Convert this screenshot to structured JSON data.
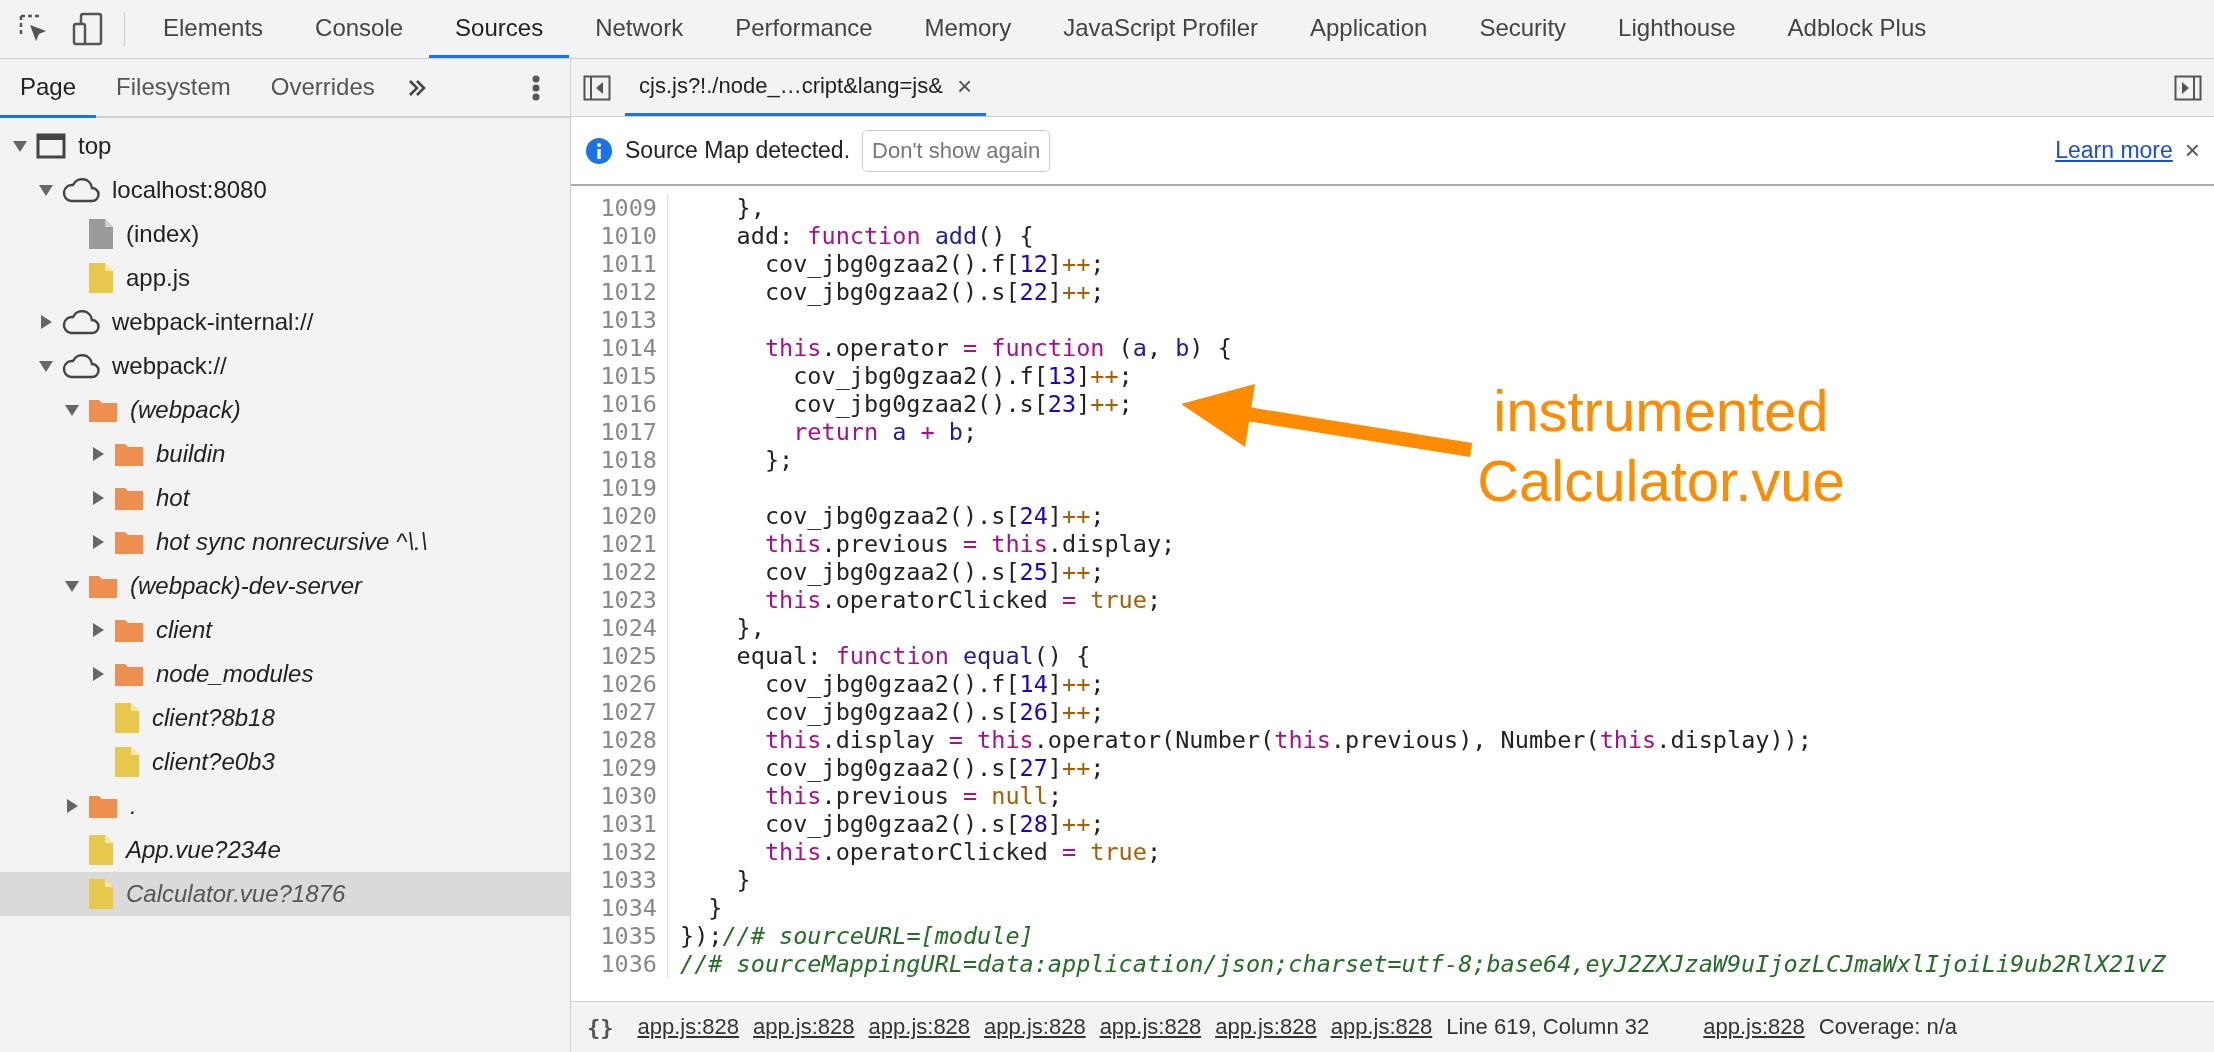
{
  "toolbar": {
    "tabs": [
      {
        "label": "Elements",
        "selected": false
      },
      {
        "label": "Console",
        "selected": false
      },
      {
        "label": "Sources",
        "selected": true
      },
      {
        "label": "Network",
        "selected": false
      },
      {
        "label": "Performance",
        "selected": false
      },
      {
        "label": "Memory",
        "selected": false
      },
      {
        "label": "JavaScript Profiler",
        "selected": false
      },
      {
        "label": "Application",
        "selected": false
      },
      {
        "label": "Security",
        "selected": false
      },
      {
        "label": "Lighthouse",
        "selected": false
      },
      {
        "label": "Adblock Plus",
        "selected": false
      }
    ]
  },
  "navigator": {
    "tabs": [
      {
        "label": "Page",
        "selected": true
      },
      {
        "label": "Filesystem",
        "selected": false
      },
      {
        "label": "Overrides",
        "selected": false
      }
    ],
    "tree": [
      {
        "label": "top",
        "kind": "frame",
        "expanded": true,
        "selected": false,
        "italic": false,
        "children": [
          {
            "label": "localhost:8080",
            "kind": "domain",
            "expanded": true,
            "selected": false,
            "italic": false,
            "children": [
              {
                "label": "(index)",
                "kind": "document",
                "selected": false,
                "italic": false
              },
              {
                "label": "app.js",
                "kind": "script",
                "selected": false,
                "italic": false
              }
            ]
          },
          {
            "label": "webpack-internal://",
            "kind": "domain",
            "expanded": false,
            "selected": false,
            "italic": false
          },
          {
            "label": "webpack://",
            "kind": "domain",
            "expanded": true,
            "selected": false,
            "italic": false,
            "children": [
              {
                "label": "(webpack)",
                "kind": "folder",
                "expanded": true,
                "selected": false,
                "italic": true,
                "children": [
                  {
                    "label": "buildin",
                    "kind": "folder",
                    "expanded": false,
                    "selected": false,
                    "italic": true
                  },
                  {
                    "label": "hot",
                    "kind": "folder",
                    "expanded": false,
                    "selected": false,
                    "italic": true
                  },
                  {
                    "label": "hot sync nonrecursive ^\\.\\",
                    "kind": "folder",
                    "expanded": false,
                    "selected": false,
                    "italic": true
                  }
                ]
              },
              {
                "label": "(webpack)-dev-server",
                "kind": "folder",
                "expanded": true,
                "selected": false,
                "italic": true,
                "children": [
                  {
                    "label": "client",
                    "kind": "folder",
                    "expanded": false,
                    "selected": false,
                    "italic": true
                  },
                  {
                    "label": "node_modules",
                    "kind": "folder",
                    "expanded": false,
                    "selected": false,
                    "italic": true
                  },
                  {
                    "label": "client?8b18",
                    "kind": "script",
                    "selected": false,
                    "italic": true
                  },
                  {
                    "label": "client?e0b3",
                    "kind": "script",
                    "selected": false,
                    "italic": true
                  }
                ]
              },
              {
                "label": ".",
                "kind": "folder",
                "expanded": false,
                "selected": false,
                "italic": true
              },
              {
                "label": "App.vue?234e",
                "kind": "script",
                "selected": false,
                "italic": true
              },
              {
                "label": "Calculator.vue?1876",
                "kind": "script",
                "selected": true,
                "italic": true
              }
            ]
          }
        ]
      }
    ]
  },
  "editor": {
    "file_tab": {
      "label": "cjs.js?!./node_…cript&lang=js&",
      "close": "×",
      "selected": true
    },
    "infobar": {
      "message": "Source Map detected.",
      "button": "Don't show again",
      "link": "Learn more",
      "close": "×"
    },
    "lines": [
      {
        "number": "1009",
        "tokens": [
          {
            "kind": "p",
            "text": "    },"
          }
        ]
      },
      {
        "number": "1010",
        "tokens": [
          {
            "kind": "p",
            "text": "    add: "
          },
          {
            "kind": "k",
            "text": "function"
          },
          {
            "kind": "d",
            "text": " add"
          },
          {
            "kind": "p",
            "text": "() {"
          }
        ]
      },
      {
        "number": "1011",
        "tokens": [
          {
            "kind": "p",
            "text": "      cov_jbg0gzaa2().f["
          },
          {
            "kind": "n",
            "text": "12"
          },
          {
            "kind": "p",
            "text": "]"
          },
          {
            "kind": "o",
            "text": "++"
          },
          {
            "kind": "p",
            "text": ";"
          }
        ]
      },
      {
        "number": "1012",
        "tokens": [
          {
            "kind": "p",
            "text": "      cov_jbg0gzaa2().s["
          },
          {
            "kind": "n",
            "text": "22"
          },
          {
            "kind": "p",
            "text": "]"
          },
          {
            "kind": "o",
            "text": "++"
          },
          {
            "kind": "p",
            "text": ";"
          }
        ]
      },
      {
        "number": "1013"
      },
      {
        "number": "1014",
        "tokens": [
          {
            "kind": "k",
            "text": "      this"
          },
          {
            "kind": "p",
            "text": ".operator "
          },
          {
            "kind": "k",
            "text": "= function"
          },
          {
            "kind": "p",
            "text": " ("
          },
          {
            "kind": "d",
            "text": "a"
          },
          {
            "kind": "p",
            "text": ", "
          },
          {
            "kind": "d",
            "text": "b"
          },
          {
            "kind": "p",
            "text": ") {"
          }
        ]
      },
      {
        "number": "1015",
        "tokens": [
          {
            "kind": "p",
            "text": "        cov_jbg0gzaa2().f["
          },
          {
            "kind": "n",
            "text": "13"
          },
          {
            "kind": "p",
            "text": "]"
          },
          {
            "kind": "o",
            "text": "++"
          },
          {
            "kind": "p",
            "text": ";"
          }
        ]
      },
      {
        "number": "1016",
        "tokens": [
          {
            "kind": "p",
            "text": "        cov_jbg0gzaa2().s["
          },
          {
            "kind": "n",
            "text": "23"
          },
          {
            "kind": "p",
            "text": "]"
          },
          {
            "kind": "o",
            "text": "++"
          },
          {
            "kind": "p",
            "text": ";"
          }
        ]
      },
      {
        "number": "1017",
        "tokens": [
          {
            "kind": "k",
            "text": "        return"
          },
          {
            "kind": "d",
            "text": " a"
          },
          {
            "kind": "k",
            "text": " +"
          },
          {
            "kind": "d",
            "text": " b"
          },
          {
            "kind": "p",
            "text": ";"
          }
        ]
      },
      {
        "number": "1018",
        "tokens": [
          {
            "kind": "p",
            "text": "      };"
          }
        ]
      },
      {
        "number": "1019"
      },
      {
        "number": "1020",
        "tokens": [
          {
            "kind": "p",
            "text": "      cov_jbg0gzaa2().s["
          },
          {
            "kind": "n",
            "text": "24"
          },
          {
            "kind": "p",
            "text": "]"
          },
          {
            "kind": "o",
            "text": "++"
          },
          {
            "kind": "p",
            "text": ";"
          }
        ]
      },
      {
        "number": "1021",
        "tokens": [
          {
            "kind": "k",
            "text": "      this"
          },
          {
            "kind": "p",
            "text": ".previous "
          },
          {
            "kind": "k",
            "text": "= this"
          },
          {
            "kind": "p",
            "text": ".display;"
          }
        ]
      },
      {
        "number": "1022",
        "tokens": [
          {
            "kind": "p",
            "text": "      cov_jbg0gzaa2().s["
          },
          {
            "kind": "n",
            "text": "25"
          },
          {
            "kind": "p",
            "text": "]"
          },
          {
            "kind": "o",
            "text": "++"
          },
          {
            "kind": "p",
            "text": ";"
          }
        ]
      },
      {
        "number": "1023",
        "tokens": [
          {
            "kind": "k",
            "text": "      this"
          },
          {
            "kind": "p",
            "text": ".operatorClicked "
          },
          {
            "kind": "k",
            "text": "="
          },
          {
            "kind": "v",
            "text": " true"
          },
          {
            "kind": "p",
            "text": ";"
          }
        ]
      },
      {
        "number": "1024",
        "tokens": [
          {
            "kind": "p",
            "text": "    },"
          }
        ]
      },
      {
        "number": "1025",
        "tokens": [
          {
            "kind": "p",
            "text": "    equal: "
          },
          {
            "kind": "k",
            "text": "function"
          },
          {
            "kind": "d",
            "text": " equal"
          },
          {
            "kind": "p",
            "text": "() {"
          }
        ]
      },
      {
        "number": "1026",
        "tokens": [
          {
            "kind": "p",
            "text": "      cov_jbg0gzaa2().f["
          },
          {
            "kind": "n",
            "text": "14"
          },
          {
            "kind": "p",
            "text": "]"
          },
          {
            "kind": "o",
            "text": "++"
          },
          {
            "kind": "p",
            "text": ";"
          }
        ]
      },
      {
        "number": "1027",
        "tokens": [
          {
            "kind": "p",
            "text": "      cov_jbg0gzaa2().s["
          },
          {
            "kind": "n",
            "text": "26"
          },
          {
            "kind": "p",
            "text": "]"
          },
          {
            "kind": "o",
            "text": "++"
          },
          {
            "kind": "p",
            "text": ";"
          }
        ]
      },
      {
        "number": "1028",
        "tokens": [
          {
            "kind": "k",
            "text": "      this"
          },
          {
            "kind": "p",
            "text": ".display "
          },
          {
            "kind": "k",
            "text": "= this"
          },
          {
            "kind": "p",
            "text": ".operator(Number("
          },
          {
            "kind": "k",
            "text": "this"
          },
          {
            "kind": "p",
            "text": ".previous), Number("
          },
          {
            "kind": "k",
            "text": "this"
          },
          {
            "kind": "p",
            "text": ".display));"
          }
        ]
      },
      {
        "number": "1029",
        "tokens": [
          {
            "kind": "p",
            "text": "      cov_jbg0gzaa2().s["
          },
          {
            "kind": "n",
            "text": "27"
          },
          {
            "kind": "p",
            "text": "]"
          },
          {
            "kind": "o",
            "text": "++"
          },
          {
            "kind": "p",
            "text": ";"
          }
        ]
      },
      {
        "number": "1030",
        "tokens": [
          {
            "kind": "k",
            "text": "      this"
          },
          {
            "kind": "p",
            "text": ".previous "
          },
          {
            "kind": "k",
            "text": "="
          },
          {
            "kind": "v",
            "text": " null"
          },
          {
            "kind": "p",
            "text": ";"
          }
        ]
      },
      {
        "number": "1031",
        "tokens": [
          {
            "kind": "p",
            "text": "      cov_jbg0gzaa2().s["
          },
          {
            "kind": "n",
            "text": "28"
          },
          {
            "kind": "p",
            "text": "]"
          },
          {
            "kind": "o",
            "text": "++"
          },
          {
            "kind": "p",
            "text": ";"
          }
        ]
      },
      {
        "number": "1032",
        "tokens": [
          {
            "kind": "k",
            "text": "      this"
          },
          {
            "kind": "p",
            "text": ".operatorClicked "
          },
          {
            "kind": "k",
            "text": "="
          },
          {
            "kind": "v",
            "text": " true"
          },
          {
            "kind": "p",
            "text": ";"
          }
        ]
      },
      {
        "number": "1033",
        "tokens": [
          {
            "kind": "p",
            "text": "    }"
          }
        ]
      },
      {
        "number": "1034",
        "tokens": [
          {
            "kind": "p",
            "text": "  }"
          }
        ]
      },
      {
        "number": "1035",
        "tokens": [
          {
            "kind": "p",
            "text": "});"
          },
          {
            "kind": "c",
            "text": "//# sourceURL=[module]"
          }
        ]
      },
      {
        "number": "1036",
        "tokens": [
          {
            "kind": "c",
            "text": "//# sourceMappingURL=data:application/json;charset=utf-8;base64,eyJ2ZXJzaW9uIjozLCJmaWxlIjoiLi9ub2RlX21vZ"
          }
        ]
      }
    ],
    "annotation": {
      "text": "instrumented Calculator.vue"
    }
  },
  "status_bar": {
    "pretty_print": "{}",
    "items": [
      {
        "kind": "link",
        "text": "app.js:828"
      },
      {
        "kind": "link",
        "text": "app.js:828"
      },
      {
        "kind": "link",
        "text": "app.js:828"
      },
      {
        "kind": "link",
        "text": "app.js:828"
      },
      {
        "kind": "link",
        "text": "app.js:828"
      },
      {
        "kind": "link",
        "text": "app.js:828"
      },
      {
        "kind": "link",
        "text": "app.js:828"
      },
      {
        "kind": "position",
        "text": "Line 619, Column 32"
      },
      {
        "kind": "link",
        "text": "app.js:828"
      },
      {
        "kind": "text",
        "text": "Coverage: n/a"
      }
    ]
  }
}
